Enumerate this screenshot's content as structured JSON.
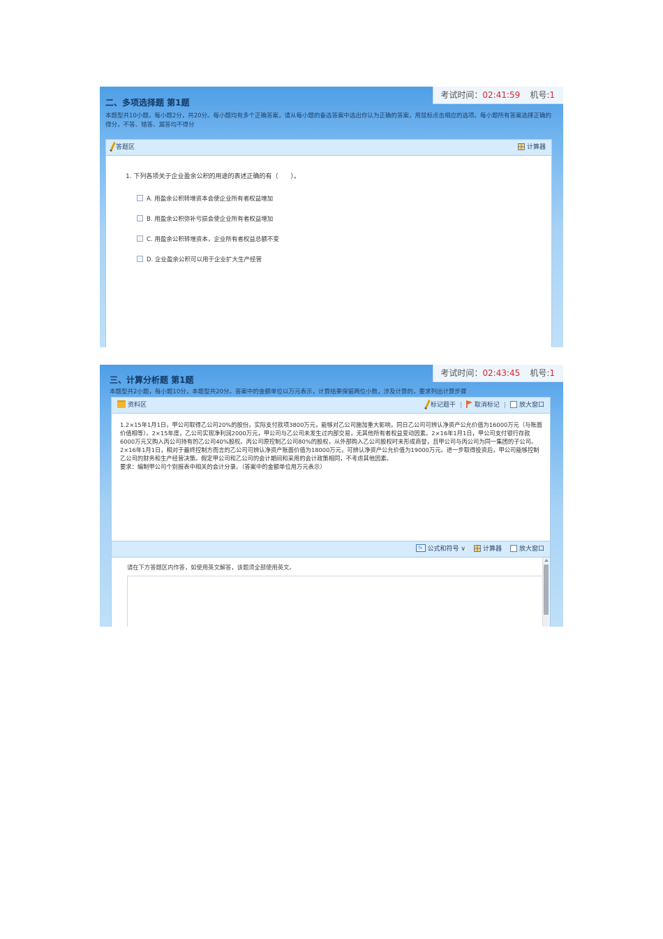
{
  "screen1": {
    "section_title": "二、多项选择题 第1题",
    "description": "本题型共10小题，每小题2分，共20分。每小题均有多个正确答案，请从每小题的备选答案中选出你认为正确的答案，用鼠标点击相应的选项。每小题所有答案选择正确的得分，不答、错答、漏答均不得分",
    "timer_label": "考试时间：",
    "timer_value": "02:41:59",
    "machine_label": "机号:",
    "machine_value": "1",
    "answer_area_label": "答题区",
    "calculator_label": "计算器",
    "question": "1. 下列各项关于企业盈余公积的用途的表述正确的有（　　）。",
    "options": [
      "A. 用盈余公积转增资本会使企业所有者权益增加",
      "B. 用盈余公积弥补亏损会使企业所有者权益增加",
      "C. 用盈余公积转增资本，企业所有者权益总额不变",
      "D. 企业盈余公积可以用于企业扩大生产经营"
    ]
  },
  "screen2": {
    "section_title": "三、计算分析题 第1题",
    "description": "本题型共2小题，每小题10分，本题型共20分。答案中的金额单位以万元表示，计算结果保留两位小数，涉及计算的，要求列出计算步骤",
    "timer_label": "考试时间：",
    "timer_value": "02:43:45",
    "machine_label": "机号:",
    "machine_value": "1",
    "material_area_label": "资料区",
    "mark_label": "标记题干",
    "unmark_label": "取消标记",
    "enlarge_label": "放大窗口",
    "material_lines": [
      "1.2×15年1月1日，甲公司取得乙公司20%的股份，实际支付款项3800万元，能够对乙公司施加重大影响，同日乙公司可辨认净资产公允价值为16000万元（与账面价值相等）。2×15年度，乙公司实现净利润2000万元，甲公司与乙公司未发生过内部交易，无其他所有者权益变动因素。2×16年1月1日，甲公司支付银行存款6000万元又购入丙公司持有的乙公司40%股权。丙公司原控制乙公司80%的股权，从外部购入乙公司股权时未形成商誉，且甲公司与丙公司为同一集团的子公司。",
      "2×16年1月1日，相对于最终控制方而言的乙公司可辨认净资产账面价值为18000万元，可辨认净资产公允价值为19000万元。进一步取得投资后，甲公司能够控制乙公司的财务和生产经营决策。假定甲公司和乙公司的会计期间和采用的会计政策相同，不考虑其他因素。",
      "要求：编制甲公司个别报表中相关的会计分录。（答案中的金额单位用万元表示）"
    ],
    "formula_label": "公式和符号",
    "calculator_label": "计算器",
    "enlarge_label_2": "放大窗口",
    "answer_hint": "请在下方答题区内作答，如使用英文解答，该题须全部使用英文。"
  }
}
